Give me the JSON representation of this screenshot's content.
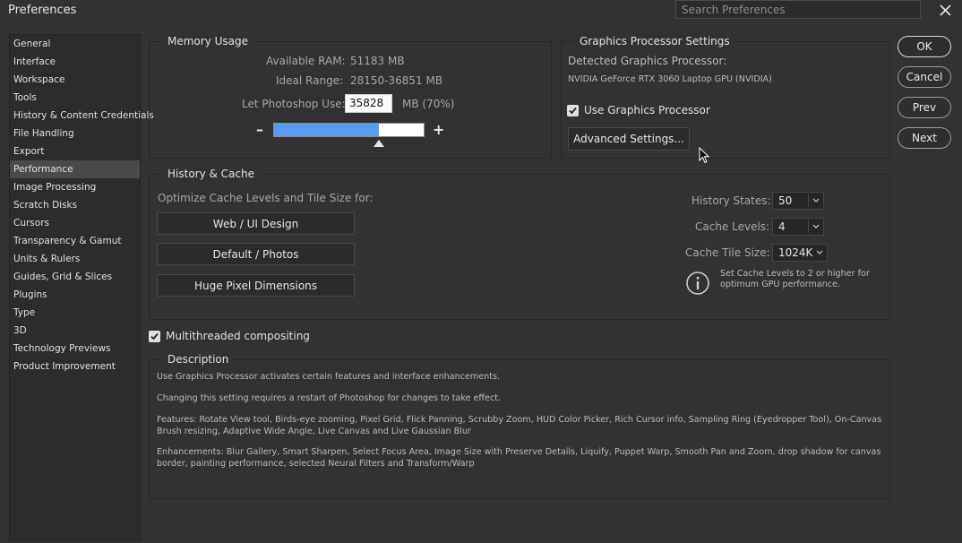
{
  "window": {
    "title": "Preferences",
    "search_placeholder": "Search Preferences"
  },
  "sidebar": {
    "items": [
      {
        "label": "General"
      },
      {
        "label": "Interface"
      },
      {
        "label": "Workspace"
      },
      {
        "label": "Tools"
      },
      {
        "label": "History & Content Credentials"
      },
      {
        "label": "File Handling"
      },
      {
        "label": "Export"
      },
      {
        "label": "Performance",
        "active": true
      },
      {
        "label": "Image Processing"
      },
      {
        "label": "Scratch Disks"
      },
      {
        "label": "Cursors"
      },
      {
        "label": "Transparency & Gamut"
      },
      {
        "label": "Units & Rulers"
      },
      {
        "label": "Guides, Grid & Slices"
      },
      {
        "label": "Plugins"
      },
      {
        "label": "Type"
      },
      {
        "label": "3D"
      },
      {
        "label": "Technology Previews"
      },
      {
        "label": "Product Improvement"
      }
    ]
  },
  "memory": {
    "title": "Memory Usage",
    "available_label": "Available RAM:",
    "available_value": "51183 MB",
    "ideal_label": "Ideal Range:",
    "ideal_value": "28150-36851 MB",
    "let_label": "Let Photoshop Use:",
    "let_value": "35828",
    "let_unit": "MB (70%)",
    "slider_fraction": 0.7,
    "minus": "–",
    "plus": "+"
  },
  "gpu": {
    "title": "Graphics Processor Settings",
    "detected_label": "Detected Graphics Processor:",
    "detected_value": "NVIDIA GeForce RTX 3060 Laptop GPU (NVIDIA)",
    "use_label": "Use Graphics Processor",
    "use_checked": true,
    "advanced_button": "Advanced Settings..."
  },
  "dialog_buttons": {
    "ok": "OK",
    "cancel": "Cancel",
    "prev": "Prev",
    "next": "Next"
  },
  "history_cache": {
    "title": "History & Cache",
    "optimize_label": "Optimize Cache Levels and Tile Size for:",
    "preset_web": "Web / UI Design",
    "preset_default": "Default / Photos",
    "preset_huge": "Huge Pixel Dimensions",
    "history_states_label": "History States:",
    "history_states_value": "50",
    "cache_levels_label": "Cache Levels:",
    "cache_levels_value": "4",
    "tile_size_label": "Cache Tile Size:",
    "tile_size_value": "1024K",
    "info_text": "Set Cache Levels to 2 or higher for optimum GPU performance."
  },
  "multithreaded": {
    "label": "Multithreaded compositing",
    "checked": true
  },
  "description": {
    "title": "Description",
    "p1": "Use Graphics Processor activates certain features and interface enhancements.",
    "p2": "Changing this setting requires a restart of Photoshop for changes to take effect.",
    "p3": "Features: Rotate View tool, Birds-eye zooming, Pixel Grid, Flick Panning, Scrubby Zoom, HUD Color Picker, Rich Cursor info, Sampling Ring (Eyedropper Tool), On-Canvas Brush resizing, Adaptive Wide Angle, Live Canvas and Live Gaussian Blur",
    "p4": "Enhancements: Blur Gallery, Smart Sharpen, Select Focus Area, Image Size with Preserve Details, Liquify, Puppet Warp, Smooth Pan and Zoom, drop shadow for canvas border, painting performance, selected Neural Filters and Transform/Warp"
  },
  "colors": {
    "background": "#323232",
    "slider_fill": "#5a9af0"
  }
}
